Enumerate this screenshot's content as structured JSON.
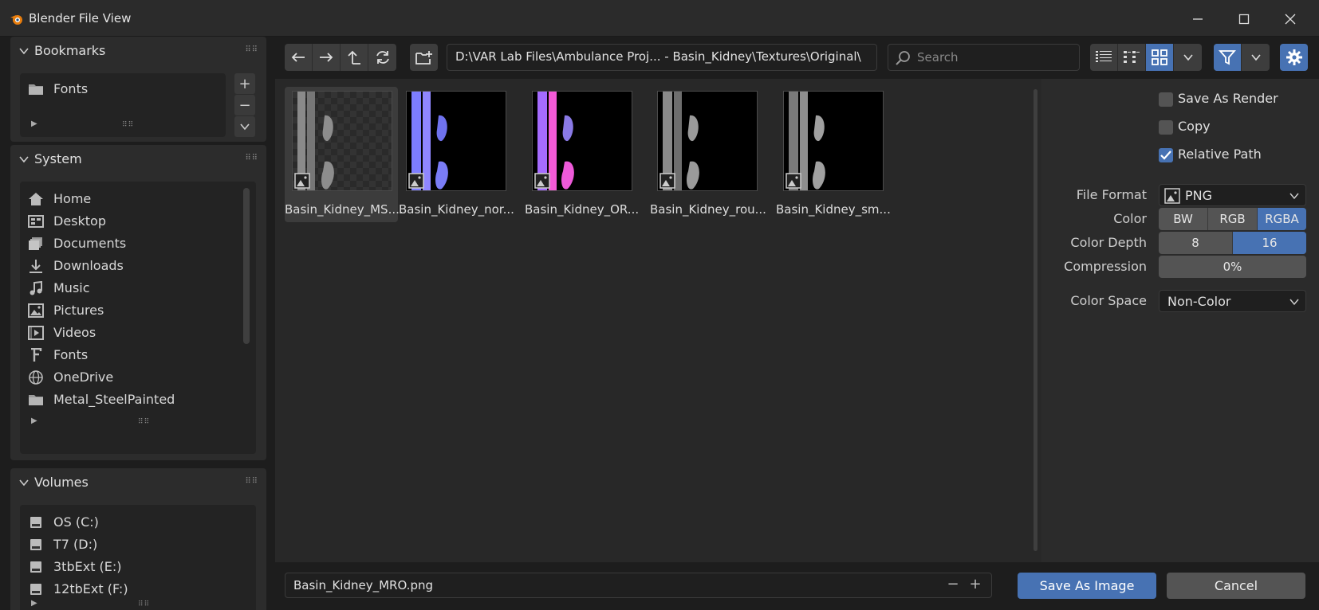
{
  "window": {
    "title": "Blender File View"
  },
  "bookmarks": {
    "title": "Bookmarks",
    "items": [
      {
        "label": "Fonts",
        "icon": "folder-icon"
      }
    ]
  },
  "system": {
    "title": "System",
    "items": [
      {
        "label": "Home",
        "icon": "home-icon"
      },
      {
        "label": "Desktop",
        "icon": "desktop-icon"
      },
      {
        "label": "Documents",
        "icon": "documents-icon"
      },
      {
        "label": "Downloads",
        "icon": "download-icon"
      },
      {
        "label": "Music",
        "icon": "music-icon"
      },
      {
        "label": "Pictures",
        "icon": "pictures-icon"
      },
      {
        "label": "Videos",
        "icon": "video-icon"
      },
      {
        "label": "Fonts",
        "icon": "font-icon"
      },
      {
        "label": "OneDrive",
        "icon": "globe-icon"
      },
      {
        "label": "Metal_SteelPainted",
        "icon": "folder-icon"
      }
    ]
  },
  "volumes": {
    "title": "Volumes",
    "items": [
      {
        "label": "OS (C:)",
        "icon": "drive-icon"
      },
      {
        "label": "T7 (D:)",
        "icon": "drive-icon"
      },
      {
        "label": "3tbExt (E:)",
        "icon": "drive-icon"
      },
      {
        "label": "12tbExt (F:)",
        "icon": "drive-icon"
      }
    ]
  },
  "toolbar": {
    "path": "D:\\VAR Lab Files\\Ambulance Proj... - Basin_Kidney\\Textures\\Original\\",
    "search_placeholder": "Search"
  },
  "files": [
    {
      "name": "Basin_Kidney_MS....",
      "style": "mro"
    },
    {
      "name": "Basin_Kidney_nor...",
      "style": "normal"
    },
    {
      "name": "Basin_Kidney_OR...",
      "style": "orm"
    },
    {
      "name": "Basin_Kidney_rou...",
      "style": "rough"
    },
    {
      "name": "Basin_Kidney_sm...",
      "style": "smooth"
    }
  ],
  "options": {
    "save_as_render": "Save As Render",
    "copy": "Copy",
    "relative_path": "Relative Path",
    "file_format_label": "File Format",
    "file_format_value": "PNG",
    "color_label": "Color",
    "color_options": [
      "BW",
      "RGB",
      "RGBA"
    ],
    "color_selected": "RGBA",
    "color_depth_label": "Color Depth",
    "color_depth_options": [
      "8",
      "16"
    ],
    "color_depth_selected": "16",
    "compression_label": "Compression",
    "compression_value": "0%",
    "color_space_label": "Color Space",
    "color_space_value": "Non-Color"
  },
  "bottom": {
    "filename": "Basin_Kidney_MRO.png",
    "save_label": "Save As Image",
    "cancel_label": "Cancel"
  },
  "colors": {
    "accent": "#4772b3",
    "bg": "#1d1d1d",
    "panel": "#2c2c2c"
  }
}
